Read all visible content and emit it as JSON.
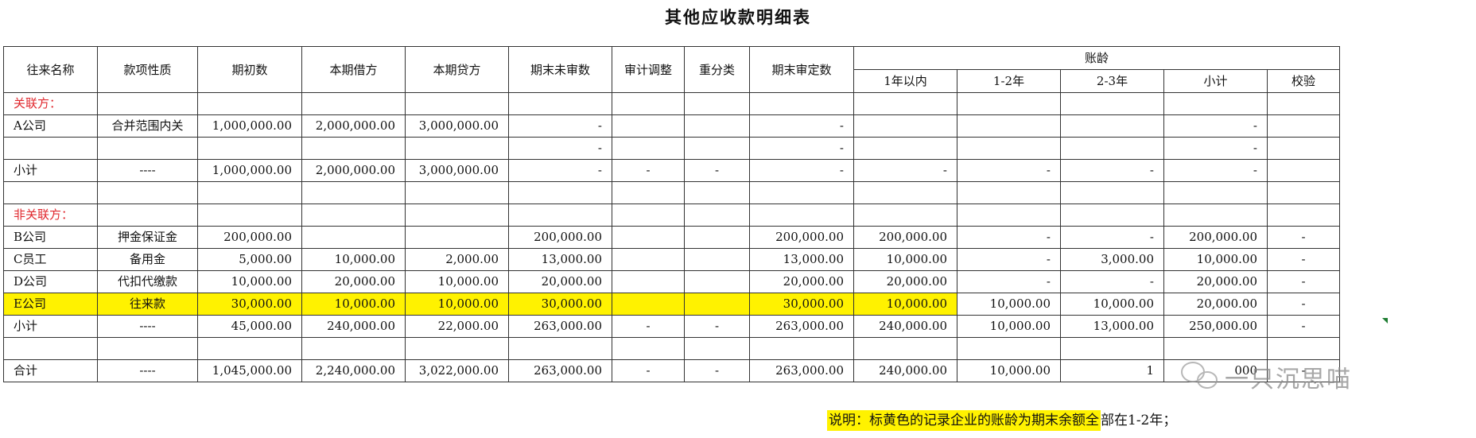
{
  "title": "其他应收款明细表",
  "headers": {
    "name": "往来名称",
    "nature": "款项性质",
    "opening": "期初数",
    "debit": "本期借方",
    "credit": "本期贷方",
    "unaudited": "期末未审数",
    "audit_adj": "审计调整",
    "reclass": "重分类",
    "audited": "期末审定数",
    "aging": "账龄",
    "aging_cols": [
      "1年以内",
      "1-2年",
      "2-3年",
      "小计",
      "校验"
    ]
  },
  "sections": {
    "related": "关联方：",
    "unrelated": "非关联方："
  },
  "rows_related": [
    {
      "name": "A公司",
      "nature": "合并范围内关",
      "opening": "1,000,000.00",
      "debit": "2,000,000.00",
      "credit": "3,000,000.00",
      "unaudited": "-",
      "audit_adj": "",
      "reclass": "",
      "audited": "-",
      "y1": "",
      "y12": "",
      "y23": "",
      "sub": "-",
      "check": ""
    },
    {
      "name": "",
      "nature": "",
      "opening": "",
      "debit": "",
      "credit": "",
      "unaudited": "-",
      "audit_adj": "",
      "reclass": "",
      "audited": "-",
      "y1": "",
      "y12": "",
      "y23": "",
      "sub": "-",
      "check": ""
    },
    {
      "name": "小计",
      "nature": "----",
      "opening": "1,000,000.00",
      "debit": "2,000,000.00",
      "credit": "3,000,000.00",
      "unaudited": "-",
      "audit_adj": "-",
      "reclass": "-",
      "audited": "-",
      "y1": "-",
      "y12": "-",
      "y23": "-",
      "sub": "-",
      "check": ""
    }
  ],
  "rows_unrelated": [
    {
      "name": "B公司",
      "nature": "押金保证金",
      "opening": "200,000.00",
      "debit": "",
      "credit": "",
      "unaudited": "200,000.00",
      "audit_adj": "",
      "reclass": "",
      "audited": "200,000.00",
      "y1": "200,000.00",
      "y12": "-",
      "y23": "-",
      "sub": "200,000.00",
      "check": "-"
    },
    {
      "name": "C员工",
      "nature": "备用金",
      "opening": "5,000.00",
      "debit": "10,000.00",
      "credit": "2,000.00",
      "unaudited": "13,000.00",
      "audit_adj": "",
      "reclass": "",
      "audited": "13,000.00",
      "y1": "10,000.00",
      "y12": "-",
      "y23": "3,000.00",
      "sub": "10,000.00",
      "check": "-"
    },
    {
      "name": "D公司",
      "nature": "代扣代缴款",
      "opening": "10,000.00",
      "debit": "20,000.00",
      "credit": "10,000.00",
      "unaudited": "20,000.00",
      "audit_adj": "",
      "reclass": "",
      "audited": "20,000.00",
      "y1": "20,000.00",
      "y12": "-",
      "y23": "-",
      "sub": "20,000.00",
      "check": "-"
    },
    {
      "name": "E公司",
      "nature": "往来款",
      "opening": "30,000.00",
      "debit": "10,000.00",
      "credit": "10,000.00",
      "unaudited": "30,000.00",
      "audit_adj": "",
      "reclass": "",
      "audited": "30,000.00",
      "y1": "10,000.00",
      "y12": "10,000.00",
      "y23": "10,000.00",
      "sub": "20,000.00",
      "check": "-",
      "highlight": true
    },
    {
      "name": "小计",
      "nature": "----",
      "opening": "45,000.00",
      "debit": "240,000.00",
      "credit": "22,000.00",
      "unaudited": "263,000.00",
      "audit_adj": "-",
      "reclass": "-",
      "audited": "263,000.00",
      "y1": "240,000.00",
      "y12": "10,000.00",
      "y23": "13,000.00",
      "sub": "250,000.00",
      "check": "-"
    }
  ],
  "total": {
    "name": "合计",
    "nature": "----",
    "opening": "1,045,000.00",
    "debit": "2,240,000.00",
    "credit": "3,022,000.00",
    "unaudited": "263,000.00",
    "audit_adj": "-",
    "reclass": "-",
    "audited": "263,000.00",
    "y1": "240,000.00",
    "y12": "10,000.00",
    "y23": "1",
    "sub": "000",
    "check": "-"
  },
  "note": {
    "highlighted": "说明：标黄色的记录企业的账龄为期末余额全",
    "rest": "部在1-2年；"
  },
  "watermark": "一只沉思喵",
  "colors": {
    "highlight": "#fff200",
    "section_label": "#e0282e",
    "grid": "#333333"
  }
}
